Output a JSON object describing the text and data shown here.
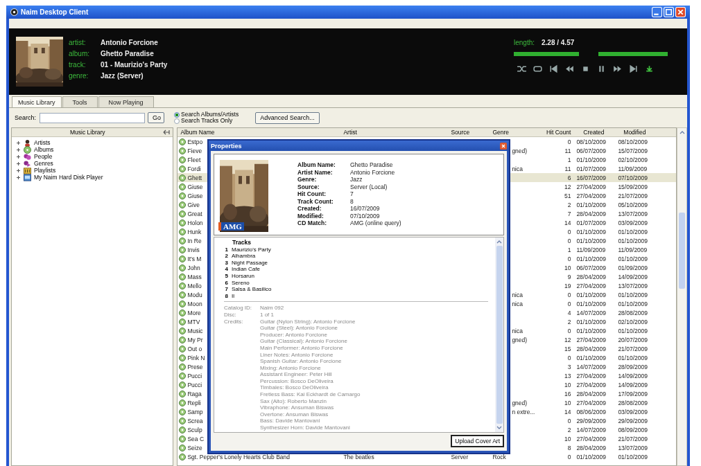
{
  "window": {
    "title": "Naim Desktop Client"
  },
  "now_playing": {
    "fields": [
      {
        "label": "artist:",
        "value": "Antonio Forcione"
      },
      {
        "label": "album:",
        "value": "Ghetto Paradise"
      },
      {
        "label": "track:",
        "value": "01 - Maurizio's Party"
      },
      {
        "label": "genre:",
        "value": "Jazz (Server)"
      }
    ],
    "length_label": "length:",
    "length": "2.28 / 4.57",
    "bars": [
      {
        "level": 1
      },
      {
        "level": 1
      }
    ]
  },
  "tabs": [
    {
      "label": "Music Library",
      "selected": true
    },
    {
      "label": "Tools",
      "selected": false
    },
    {
      "label": "Now Playing",
      "selected": false
    }
  ],
  "search": {
    "label": "Search:",
    "button": "Go",
    "advanced": "Advanced Search...",
    "options": [
      {
        "label": "Search Albums/Artists",
        "selected": true
      },
      {
        "label": "Search Tracks Only",
        "selected": false
      }
    ]
  },
  "library": {
    "title": "Music Library",
    "items": [
      {
        "label": "Artists",
        "kind": "artists",
        "expanded": false
      },
      {
        "label": "Albums",
        "kind": "albums",
        "expanded": false
      },
      {
        "label": "People",
        "kind": "people",
        "expanded": false
      },
      {
        "label": "Genres",
        "kind": "genres",
        "expanded": false
      },
      {
        "label": "Playlists",
        "kind": "playlists",
        "expanded": false
      },
      {
        "label": "My Naim Hard Disk Player",
        "kind": "player",
        "expanded": false
      }
    ]
  },
  "table": {
    "columns": [
      "Album Name",
      "Artist",
      "Source",
      "Genre",
      "Hit Count",
      "Created",
      "Modified"
    ],
    "rows": [
      {
        "album": "Estpo",
        "hits": "0",
        "created": "08/10/2009",
        "modified": "08/10/2009",
        "selected": false
      },
      {
        "album": "Fieve",
        "genre": "gned)",
        "hits": "11",
        "created": "06/07/2009",
        "modified": "15/07/2009",
        "selected": false
      },
      {
        "album": "Fleet",
        "hits": "1",
        "created": "01/10/2009",
        "modified": "02/10/2009",
        "selected": false
      },
      {
        "album": "Fordi",
        "genre": "nica",
        "hits": "11",
        "created": "01/07/2009",
        "modified": "11/09/2009",
        "selected": false
      },
      {
        "album": "Ghett",
        "hits": "6",
        "created": "16/07/2009",
        "modified": "07/10/2009",
        "selected": true
      },
      {
        "album": "Giuse",
        "hits": "12",
        "created": "27/04/2009",
        "modified": "15/09/2009",
        "selected": false
      },
      {
        "album": "Giuse",
        "hits": "51",
        "created": "27/04/2009",
        "modified": "21/07/2009",
        "selected": false
      },
      {
        "album": "Give",
        "hits": "2",
        "created": "01/10/2009",
        "modified": "05/10/2009",
        "selected": false
      },
      {
        "album": "Great",
        "hits": "7",
        "created": "28/04/2009",
        "modified": "13/07/2009",
        "selected": false
      },
      {
        "album": "Holon",
        "hits": "14",
        "created": "01/07/2009",
        "modified": "03/09/2009",
        "selected": false
      },
      {
        "album": "Hunk",
        "hits": "0",
        "created": "01/10/2009",
        "modified": "01/10/2009",
        "selected": false
      },
      {
        "album": "In Re",
        "hits": "0",
        "created": "01/10/2009",
        "modified": "01/10/2009",
        "selected": false
      },
      {
        "album": "Invis",
        "hits": "1",
        "created": "11/09/2009",
        "modified": "11/09/2009",
        "selected": false
      },
      {
        "album": "It's M",
        "hits": "0",
        "created": "01/10/2009",
        "modified": "01/10/2009",
        "selected": false
      },
      {
        "album": "John",
        "hits": "10",
        "created": "06/07/2009",
        "modified": "01/09/2009",
        "selected": false
      },
      {
        "album": "Mass",
        "hits": "9",
        "created": "28/04/2009",
        "modified": "14/09/2009",
        "selected": false
      },
      {
        "album": "Mello",
        "hits": "19",
        "created": "27/04/2009",
        "modified": "13/07/2009",
        "selected": false
      },
      {
        "album": "Modu",
        "genre": "nica",
        "hits": "0",
        "created": "01/10/2009",
        "modified": "01/10/2009",
        "selected": false
      },
      {
        "album": "Moon",
        "genre": "nica",
        "hits": "0",
        "created": "01/10/2009",
        "modified": "01/10/2009",
        "selected": false
      },
      {
        "album": "More",
        "hits": "4",
        "created": "14/07/2009",
        "modified": "28/08/2009",
        "selected": false
      },
      {
        "album": "MTV",
        "hits": "2",
        "created": "01/10/2009",
        "modified": "02/10/2009",
        "selected": false
      },
      {
        "album": "Music",
        "genre": "nica",
        "hits": "0",
        "created": "01/10/2009",
        "modified": "01/10/2009",
        "selected": false
      },
      {
        "album": "My Pr",
        "genre": "gned)",
        "hits": "12",
        "created": "27/04/2009",
        "modified": "20/07/2009",
        "selected": false
      },
      {
        "album": "Out o",
        "hits": "15",
        "created": "28/04/2009",
        "modified": "21/07/2009",
        "selected": false
      },
      {
        "album": "Pink N",
        "hits": "0",
        "created": "01/10/2009",
        "modified": "01/10/2009",
        "selected": false
      },
      {
        "album": "Prese",
        "hits": "3",
        "created": "14/07/2009",
        "modified": "28/09/2009",
        "selected": false
      },
      {
        "album": "Pucci",
        "hits": "13",
        "created": "27/04/2009",
        "modified": "14/09/2009",
        "selected": false
      },
      {
        "album": "Pucci",
        "hits": "10",
        "created": "27/04/2009",
        "modified": "14/09/2009",
        "selected": false
      },
      {
        "album": "Raga",
        "hits": "16",
        "created": "28/04/2009",
        "modified": "17/09/2009",
        "selected": false
      },
      {
        "album": "Repli",
        "genre": "gned)",
        "hits": "10",
        "created": "27/04/2009",
        "modified": "28/08/2009",
        "selected": false
      },
      {
        "album": "Samp",
        "genre": "n extre...",
        "hits": "14",
        "created": "08/06/2009",
        "modified": "03/09/2009",
        "selected": false
      },
      {
        "album": "Screa",
        "hits": "0",
        "created": "29/09/2009",
        "modified": "29/09/2009",
        "selected": false
      },
      {
        "album": "Sculp",
        "hits": "2",
        "created": "14/07/2009",
        "modified": "08/09/2009",
        "selected": false
      },
      {
        "album": "Sea C",
        "hits": "10",
        "created": "27/04/2009",
        "modified": "21/07/2009",
        "selected": false
      },
      {
        "album": "Seize",
        "hits": "8",
        "created": "28/04/2009",
        "modified": "13/07/2009",
        "selected": false
      },
      {
        "album": "Sgt. Pepper's Lonely Hearts Club Band",
        "artist": "The beatles",
        "source": "Server",
        "genre": "Rock",
        "hits": "0",
        "created": "01/10/2009",
        "modified": "01/10/2009",
        "selected": false
      }
    ]
  },
  "dialog": {
    "title": "Properties",
    "badge": "AMG",
    "properties": [
      {
        "label": "Album Name:",
        "value": "Ghetto Paradise"
      },
      {
        "label": "Artist Name:",
        "value": "Antonio Forcione"
      },
      {
        "label": "Genre:",
        "value": "Jazz"
      },
      {
        "label": "Source:",
        "value": "Server (Local)"
      },
      {
        "label": "Hit Count:",
        "value": "7"
      },
      {
        "label": "Track Count:",
        "value": "8"
      },
      {
        "label": "Created:",
        "value": "16/07/2009"
      },
      {
        "label": "Modified:",
        "value": "07/10/2009"
      },
      {
        "label": "CD Match:",
        "value": "AMG (online query)"
      }
    ],
    "tracks_title": "Tracks",
    "tracks": [
      {
        "number": "1",
        "title": "Maurizio's Party"
      },
      {
        "number": "2",
        "title": "Alhambra"
      },
      {
        "number": "3",
        "title": "Night Passage"
      },
      {
        "number": "4",
        "title": "Indian Cafe"
      },
      {
        "number": "5",
        "title": "Horsarun"
      },
      {
        "number": "6",
        "title": "Sereno"
      },
      {
        "number": "7",
        "title": "Salsa & Basilico"
      },
      {
        "number": "8",
        "title": "Il"
      }
    ],
    "details": [
      {
        "label": "Catalog ID:",
        "lines": [
          "Naim 092"
        ]
      },
      {
        "label": "Disc:",
        "lines": [
          "1 of 1"
        ]
      },
      {
        "label": "Credits:",
        "lines": [
          "Guitar (Nylon String): Antonio Forcione",
          "Guitar (Steel): Antonio Forcione",
          "Producer: Antonio Forcione",
          "Guitar (Classical): Antonio Forcione",
          "Main Performer: Antonio Forcione",
          "Liner Notes: Antonio Forcione",
          "Spanish Guitar: Antonio Forcione",
          "Mixing: Antonio Forcione",
          "Assistant Engineer: Peter Hill",
          "Percussion: Bosco DeOliveira",
          "Timbales: Bosco DeOliveira",
          "Fretless Bass: Kai Eckhardt de Camargo",
          "Sax (Alto): Roberto Manzin",
          "Vibraphone: Ansuman Biswas",
          "Overtone: Ansuman Biswas",
          "Bass: Davide Mantovani",
          "Synthesizer Horn: Davide Mantovani"
        ]
      }
    ],
    "upload_button": "Upload Cover Art"
  }
}
